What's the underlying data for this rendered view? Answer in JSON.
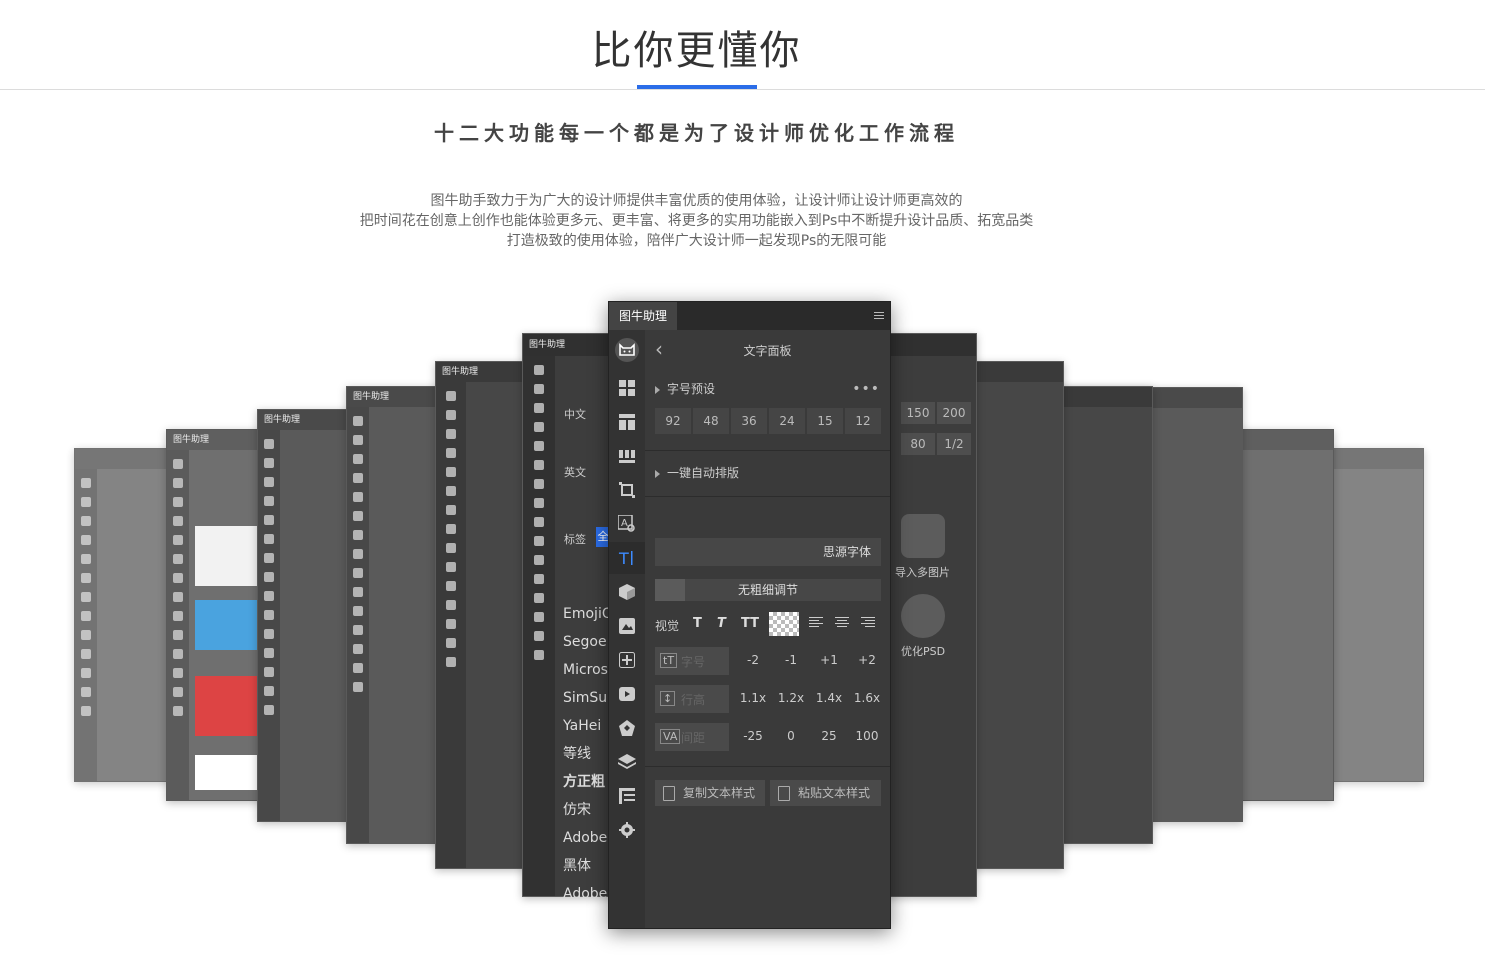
{
  "hero": {
    "title": "比你更懂你",
    "subtitle": "十二大功能每一个都是为了设计师优化工作流程",
    "description": [
      "图牛助手致力于为广大的设计师提供丰富优质的使用体验，让设计师让设计师更高效的",
      "把时间花在创意上创作也能体验更多元、更丰富、将更多的实用功能嵌入到Ps中不断提升设计品质、拓宽品类",
      "打造极致的使用体验，陪伴广大设计师一起发现Ps的无限可能"
    ],
    "accent_color": "#2b6de8"
  },
  "panel": {
    "tab_label": "图牛助理",
    "title": "文字面板",
    "size_preset_label": "字号预设",
    "sizes": [
      "92",
      "48",
      "36",
      "24",
      "15",
      "12"
    ],
    "auto_layout_label": "一键自动排版",
    "font_name": "思源字体",
    "weight_label": "无粗细调节",
    "visual_label": "视觉",
    "style_buttons": [
      "T",
      "T",
      "TT"
    ],
    "rows": [
      {
        "label": "字号",
        "icon": "tT",
        "values": [
          "-2",
          "-1",
          "+1",
          "+2"
        ]
      },
      {
        "label": "行高",
        "icon": "↕",
        "values": [
          "1.1x",
          "1.2x",
          "1.4x",
          "1.6x"
        ]
      },
      {
        "label": "间距",
        "icon": "VA",
        "values": [
          "-25",
          "0",
          "25",
          "100"
        ]
      }
    ],
    "copy_style_label": "复制文本样式",
    "paste_style_label": "粘贴文本样式"
  },
  "background_panel": {
    "tab_label": "图牛助理",
    "fonts": [
      "EmojiO",
      "Segoe U",
      "Micros",
      "SimSun-",
      "YaHei",
      "等线",
      "方正粗",
      "仿宋",
      "Adobe",
      "黑体",
      "Adobe"
    ],
    "right_values_top": [
      "150",
      "200"
    ],
    "right_values_bottom": [
      "80",
      "1/2"
    ],
    "import_label": "导入多图片",
    "optimize_label": "优化PSD",
    "tag_label": "标签",
    "tag_value": "全",
    "cn_label": "中文",
    "en_label": "英文"
  }
}
